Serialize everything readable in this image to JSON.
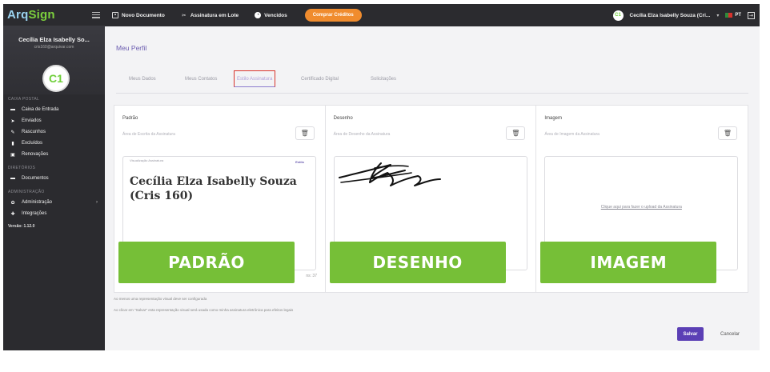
{
  "sidebar": {
    "logo_prefix": "Arq",
    "logo_suffix": "Sign",
    "profile_name": "Cecília Elza Isabelly So...",
    "profile_email": "cris160@arquivar.com",
    "avatar_initials": "C1",
    "section_mailbox": "CAIXA POSTAL",
    "items_mailbox": [
      {
        "label": "Caixa de Entrada",
        "icon": "inbox-icon"
      },
      {
        "label": "Enviados",
        "icon": "send-icon"
      },
      {
        "label": "Rascunhos",
        "icon": "pencil-icon"
      },
      {
        "label": "Excluídos",
        "icon": "trash-icon"
      },
      {
        "label": "Renovações",
        "icon": "calendar-icon"
      }
    ],
    "section_directories": "DIRETÓRIOS",
    "items_directories": [
      {
        "label": "Documentos",
        "icon": "folder-icon"
      }
    ],
    "section_admin": "ADMINISTRAÇÃO",
    "items_admin": [
      {
        "label": "Administração",
        "icon": "gear-icon"
      },
      {
        "label": "Integrações",
        "icon": "puzzle-icon"
      }
    ],
    "version": "Versão: 1.12.0"
  },
  "topbar": {
    "new_document": "Novo Documento",
    "batch_signature": "Assinatura em Lote",
    "expired": "Vencidos",
    "buy_credits": "Comprar Créditos",
    "user_initials": "C1",
    "user_name": "Cecília Elza Isabelly Souza (Cri...",
    "language": "PT"
  },
  "page": {
    "title": "Meu Perfil",
    "tabs": [
      "Meus Dados",
      "Meus Contatos",
      "Estilo Assinatura",
      "Certificado Digital",
      "Solicitações"
    ],
    "active_tab": "Estilo Assinatura"
  },
  "cards": {
    "standard": {
      "title": "Padrão",
      "subtitle": "Área de Escrita da Assinatura",
      "preview_label": "Visualização Assinatura",
      "style_label": "Estilo",
      "signature_text": "Cecília Elza Isabelly Souza (Cris 160)",
      "counter": "ns: 37",
      "badge": "PADRÃO"
    },
    "drawing": {
      "title": "Desenho",
      "subtitle": "Área de Desenho da Assinatura",
      "badge": "DESENHO"
    },
    "image": {
      "title": "Imagem",
      "subtitle": "Área de Imagem da Assinatura",
      "upload_text": "Clique aqui para fazer o upload da Assinatura",
      "badge": "IMAGEM"
    }
  },
  "hints": {
    "line1": "Ao menos uma representação visual deve ser configurada",
    "line2": "Ao clicar em \"Salvar\" esta representação visual será usada como minha assinatura eletrônica para efeitos legais"
  },
  "actions": {
    "save": "Salvar",
    "cancel": "Cancelar"
  },
  "colors": {
    "sidebar_bg": "#2b2b2f",
    "brand_purple": "#5b3fb5",
    "accent_orange": "#f08c2e",
    "badge_green": "#76bf37",
    "active_tab_border": "#d9342c"
  }
}
